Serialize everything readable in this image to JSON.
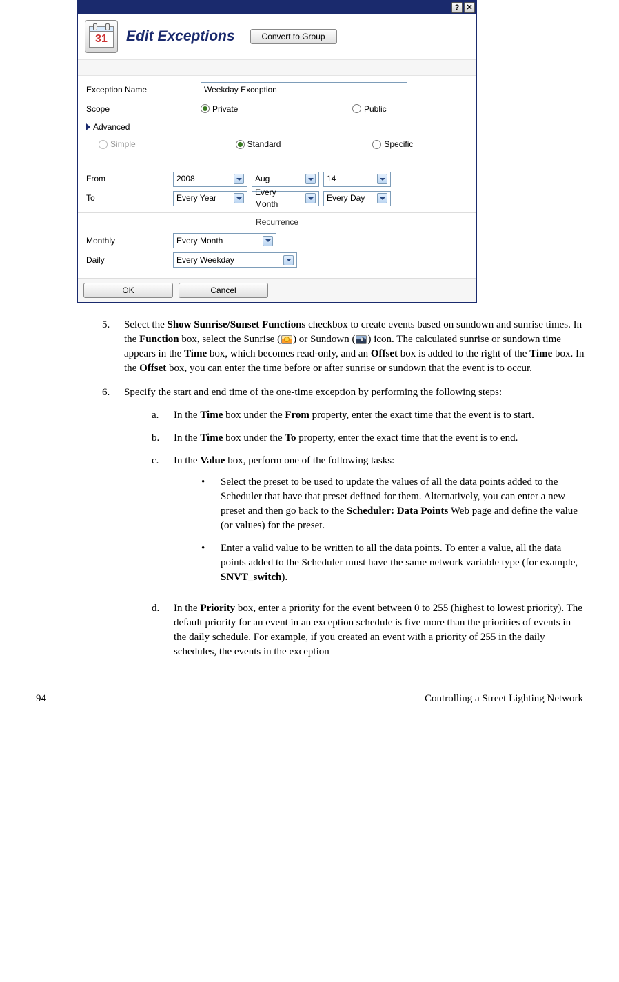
{
  "dialog": {
    "calendar_day": "31",
    "title": "Edit Exceptions",
    "convert_button": "Convert to Group",
    "labels": {
      "exception_name": "Exception Name",
      "scope": "Scope",
      "advanced": "Advanced",
      "from": "From",
      "to": "To",
      "recurrence": "Recurrence",
      "monthly": "Monthly",
      "daily": "Daily"
    },
    "inputs": {
      "exception_name_value": "Weekday Exception"
    },
    "scope_options": {
      "private": "Private",
      "public": "Public"
    },
    "scope_selected": "private",
    "mode_options": {
      "simple": "Simple",
      "standard": "Standard",
      "specific": "Specific"
    },
    "mode_selected": "standard",
    "from_values": {
      "year": "2008",
      "month": "Aug",
      "day": "14"
    },
    "to_values": {
      "year": "Every Year",
      "month": "Every Month",
      "day": "Every Day"
    },
    "recurrence_values": {
      "monthly": "Every Month",
      "daily": "Every Weekday"
    },
    "buttons": {
      "ok": "OK",
      "cancel": "Cancel"
    }
  },
  "doc": {
    "items": [
      {
        "num": "5.",
        "parts": [
          "Select the ",
          {
            "b": "Show Sunrise/Sunset Functions"
          },
          " checkbox to create events based on sundown and sunrise times.  In the ",
          {
            "b": "Function"
          },
          " box, select the Sunrise (",
          {
            "icon": "sunrise"
          },
          ") or Sundown (",
          {
            "icon": "sundown"
          },
          ") icon.  The calculated sunrise or sundown time appears in the ",
          {
            "b": "Time"
          },
          " box, which becomes read-only, and an ",
          {
            "b": "Offset"
          },
          " box is added to the right of the ",
          {
            "b": "Time"
          },
          " box.  In the ",
          {
            "b": "Offset"
          },
          " box, you can enter the time before or after sunrise or sundown that the event is to occur."
        ]
      },
      {
        "num": "6.",
        "text": "Specify the start and end time of the one-time exception by performing the following steps:",
        "sub": [
          {
            "letter": "a.",
            "parts": [
              "In the ",
              {
                "b": "Time"
              },
              " box under the ",
              {
                "b": "From"
              },
              " property, enter the exact time that the event is to start."
            ]
          },
          {
            "letter": "b.",
            "parts": [
              "In the ",
              {
                "b": "Time"
              },
              " box under the ",
              {
                "b": "To"
              },
              " property, enter the exact time that the event is to end."
            ]
          },
          {
            "letter": "c.",
            "parts": [
              "In the ",
              {
                "b": "Value"
              },
              " box, perform one of the following tasks:"
            ],
            "bullets": [
              [
                "Select the preset to be used to update the values of all the data points added to the Scheduler that have that preset defined for them.  Alternatively, you can enter a new preset and then go back to the ",
                {
                  "b": "Scheduler: Data Points"
                },
                " Web page and define the value (or values) for the preset."
              ],
              [
                "Enter a valid value to be written to all the data points.  To enter a value, all the data points added to the Scheduler must have the same network variable type (for example, ",
                {
                  "b": "SNVT_switch"
                },
                ")."
              ]
            ]
          },
          {
            "letter": "d.",
            "parts": [
              "In the ",
              {
                "b": "Priority"
              },
              " box, enter a priority for the event between 0 to 255 (highest to lowest priority).  The default priority for an event in an exception schedule is five more than the priorities of events in the daily schedule.  For example, if you created an event with a priority of 255 in the daily schedules, the events in the exception"
            ]
          }
        ]
      }
    ]
  },
  "footer": {
    "page_number": "94",
    "title": "Controlling a Street Lighting Network"
  }
}
